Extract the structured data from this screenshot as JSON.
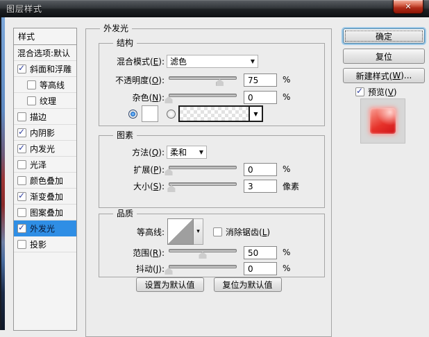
{
  "window": {
    "title": "图层样式"
  },
  "icons": {
    "close": "✕",
    "dropdown_arrow": "▼",
    "small_arrow": "▾"
  },
  "sidebar": {
    "header": "样式",
    "items": [
      {
        "label": "混合选项:默认",
        "checkbox": false,
        "checked": false,
        "indent": false,
        "selected": false
      },
      {
        "label": "斜面和浮雕",
        "checkbox": true,
        "checked": true,
        "indent": false,
        "selected": false
      },
      {
        "label": "等高线",
        "checkbox": true,
        "checked": false,
        "indent": true,
        "selected": false
      },
      {
        "label": "纹理",
        "checkbox": true,
        "checked": false,
        "indent": true,
        "selected": false
      },
      {
        "label": "描边",
        "checkbox": true,
        "checked": false,
        "indent": false,
        "selected": false
      },
      {
        "label": "内阴影",
        "checkbox": true,
        "checked": true,
        "indent": false,
        "selected": false
      },
      {
        "label": "内发光",
        "checkbox": true,
        "checked": true,
        "indent": false,
        "selected": false
      },
      {
        "label": "光泽",
        "checkbox": true,
        "checked": false,
        "indent": false,
        "selected": false
      },
      {
        "label": "颜色叠加",
        "checkbox": true,
        "checked": false,
        "indent": false,
        "selected": false
      },
      {
        "label": "渐变叠加",
        "checkbox": true,
        "checked": true,
        "indent": false,
        "selected": false
      },
      {
        "label": "图案叠加",
        "checkbox": true,
        "checked": false,
        "indent": false,
        "selected": false
      },
      {
        "label": "外发光",
        "checkbox": true,
        "checked": true,
        "indent": false,
        "selected": true
      },
      {
        "label": "投影",
        "checkbox": true,
        "checked": false,
        "indent": false,
        "selected": false
      }
    ]
  },
  "panel": {
    "title": "外发光",
    "structure": {
      "title": "结构",
      "blend_mode_label": "混合模式(E):",
      "blend_mode_value": "滤色",
      "opacity_label": "不透明度(O):",
      "opacity_value": "75",
      "opacity_unit": "%",
      "opacity_percent": 75,
      "noise_label": "杂色(N):",
      "noise_value": "0",
      "noise_unit": "%",
      "noise_percent": 0
    },
    "elements": {
      "title": "图素",
      "technique_label": "方法(Q):",
      "technique_value": "柔和",
      "spread_label": "扩展(P):",
      "spread_value": "0",
      "spread_unit": "%",
      "spread_percent": 0,
      "size_label": "大小(S):",
      "size_value": "3",
      "size_unit": "像素",
      "size_percent": 4
    },
    "quality": {
      "title": "品质",
      "contour_label": "等高线:",
      "antialias_label": "消除锯齿(L)",
      "antialias_checked": false,
      "range_label": "范围(R):",
      "range_value": "50",
      "range_unit": "%",
      "range_percent": 50,
      "jitter_label": "抖动(J):",
      "jitter_value": "0",
      "jitter_unit": "%",
      "jitter_percent": 0
    },
    "footer_buttons": {
      "make_default": "设置为默认值",
      "reset_default": "复位为默认值"
    }
  },
  "actions": {
    "ok": "确定",
    "reset": "复位",
    "new_style": "新建样式(W)...",
    "preview_label": "预览(V)",
    "preview_checked": true
  }
}
